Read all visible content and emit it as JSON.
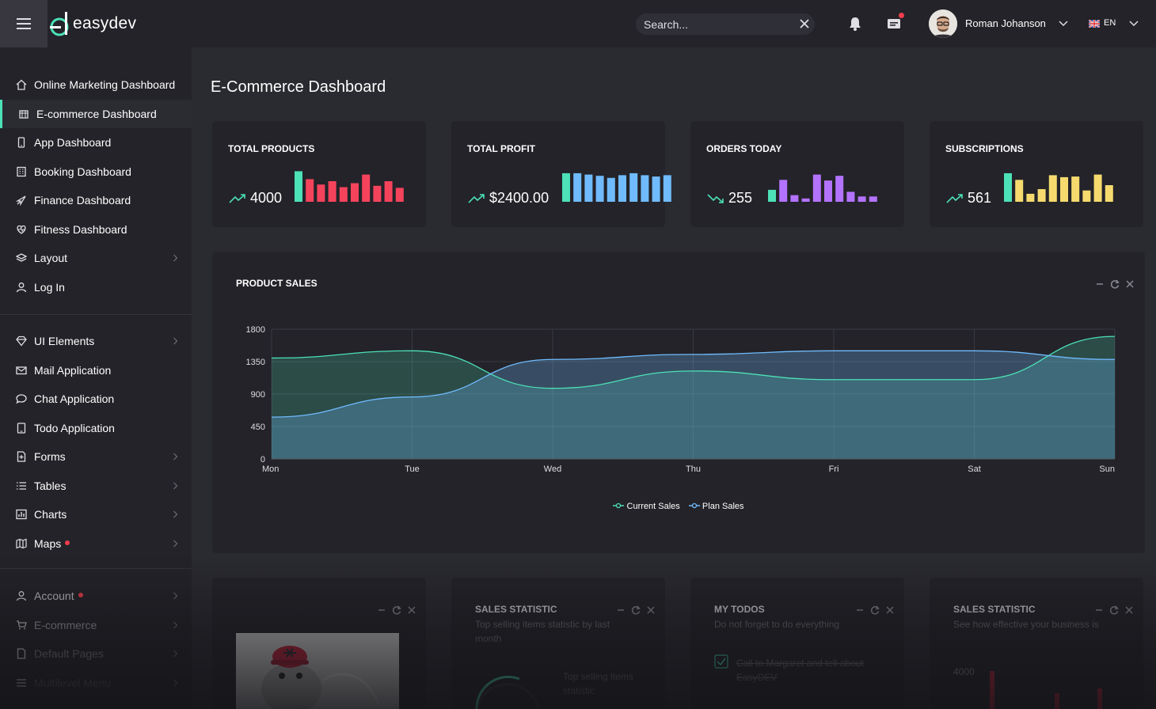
{
  "app": {
    "logo_text": "easydev"
  },
  "topbar": {
    "search_placeholder": "Search...",
    "user_name": "Roman Johanson",
    "language": "EN",
    "icons": [
      "menu-icon",
      "close-icon",
      "bell-icon",
      "mail-icon",
      "chevron-down-icon",
      "uk-flag-icon"
    ]
  },
  "sidebar": {
    "section1": [
      {
        "label": "Online Marketing Dashboard",
        "icon": "home-icon"
      },
      {
        "label": "E-commerce Dashboard",
        "icon": "store-icon",
        "active": true
      },
      {
        "label": "App Dashboard",
        "icon": "smartphone-icon"
      },
      {
        "label": "Booking Dashboard",
        "icon": "apartment-icon"
      },
      {
        "label": "Finance Dashboard",
        "icon": "rocket-icon"
      },
      {
        "label": "Fitness Dashboard",
        "icon": "heart-pulse-icon"
      },
      {
        "label": "Layout",
        "icon": "layers-icon"
      },
      {
        "label": "Log In",
        "icon": "user-icon"
      }
    ],
    "section2": [
      {
        "label": "UI Elements",
        "icon": "diamond-icon"
      },
      {
        "label": "Mail Application",
        "icon": "envelope-icon"
      },
      {
        "label": "Chat Application",
        "icon": "bubble-icon"
      },
      {
        "label": "Todo Application",
        "icon": "tablet-icon"
      },
      {
        "label": "Forms",
        "icon": "file-add-icon"
      },
      {
        "label": "Tables",
        "icon": "list-icon"
      },
      {
        "label": "Charts",
        "icon": "chart-bars-icon"
      },
      {
        "label": "Maps",
        "icon": "map-icon",
        "dot": true
      }
    ],
    "section3": [
      {
        "label": "Account",
        "icon": "user-icon",
        "dot": true
      },
      {
        "label": "E-commerce",
        "icon": "cart-icon"
      },
      {
        "label": "Default Pages",
        "icon": "file-empty-icon"
      },
      {
        "label": "Multilevel Menu",
        "icon": "menu-icon"
      }
    ]
  },
  "page": {
    "title": "E-Commerce Dashboard"
  },
  "kpis": [
    {
      "title": "Total Products",
      "value": "4000",
      "trend": "up",
      "color": "#f6435c",
      "first_color": "#4ce1b6",
      "bars": [
        0.92,
        0.68,
        0.52,
        0.62,
        0.44,
        0.56,
        0.82,
        0.48,
        0.62,
        0.42
      ]
    },
    {
      "title": "Total Profit",
      "value": "$2400.00",
      "trend": "up",
      "color": "#70bbfd",
      "first_color": "#4ce1b6",
      "bars": [
        0.86,
        0.86,
        0.82,
        0.78,
        0.72,
        0.8,
        0.86,
        0.8,
        0.76,
        0.8
      ]
    },
    {
      "title": "Orders Today",
      "value": "255",
      "trend": "down",
      "color": "#b473ff",
      "first_color": "#4ce1b6",
      "bars": [
        0.36,
        0.66,
        0.2,
        0.1,
        0.82,
        0.64,
        0.78,
        0.3,
        0.16,
        0.16
      ]
    },
    {
      "title": "Subscriptions",
      "value": "561",
      "trend": "up",
      "color": "#f6da6e",
      "first_color": "#4ce1b6",
      "bars": [
        0.86,
        0.66,
        0.24,
        0.38,
        0.8,
        0.74,
        0.76,
        0.34,
        0.82,
        0.5
      ]
    }
  ],
  "product_sales": {
    "title": "PRODUCT SALES",
    "controls": [
      "minus-icon",
      "refresh-icon",
      "close-icon"
    ],
    "legend": [
      "Current Sales",
      "Plan Sales"
    ]
  },
  "chart_data": {
    "type": "area",
    "categories": [
      "Mon",
      "Tue",
      "Wed",
      "Thu",
      "Fri",
      "Sat",
      "Sun"
    ],
    "ylim": [
      0,
      1800
    ],
    "yticks": [
      0,
      450,
      900,
      1350,
      1800
    ],
    "grid": true,
    "legend_placement": "bottom-center",
    "series": [
      {
        "name": "Current Sales",
        "color": "#4ce1b6",
        "values": [
          1400,
          1500,
          980,
          1220,
          1100,
          1100,
          1700
        ]
      },
      {
        "name": "Plan Sales",
        "color": "#70bbfd",
        "values": [
          580,
          860,
          1380,
          1450,
          1500,
          1500,
          1380
        ]
      }
    ]
  },
  "lower_cards": [
    {
      "title": "",
      "subtitle": ""
    },
    {
      "title": "SALES STATISTIC",
      "subtitle": "Top selling items statistic by last month",
      "extra": "Top selling items statistic"
    },
    {
      "title": "MY TODOS",
      "subtitle": "Do not forget to do everything",
      "todo": "Call to Margaret and tell about EasyDEV"
    },
    {
      "title": "SALES STATISTIC",
      "subtitle": "See how effective your business is",
      "value": "4000"
    }
  ]
}
